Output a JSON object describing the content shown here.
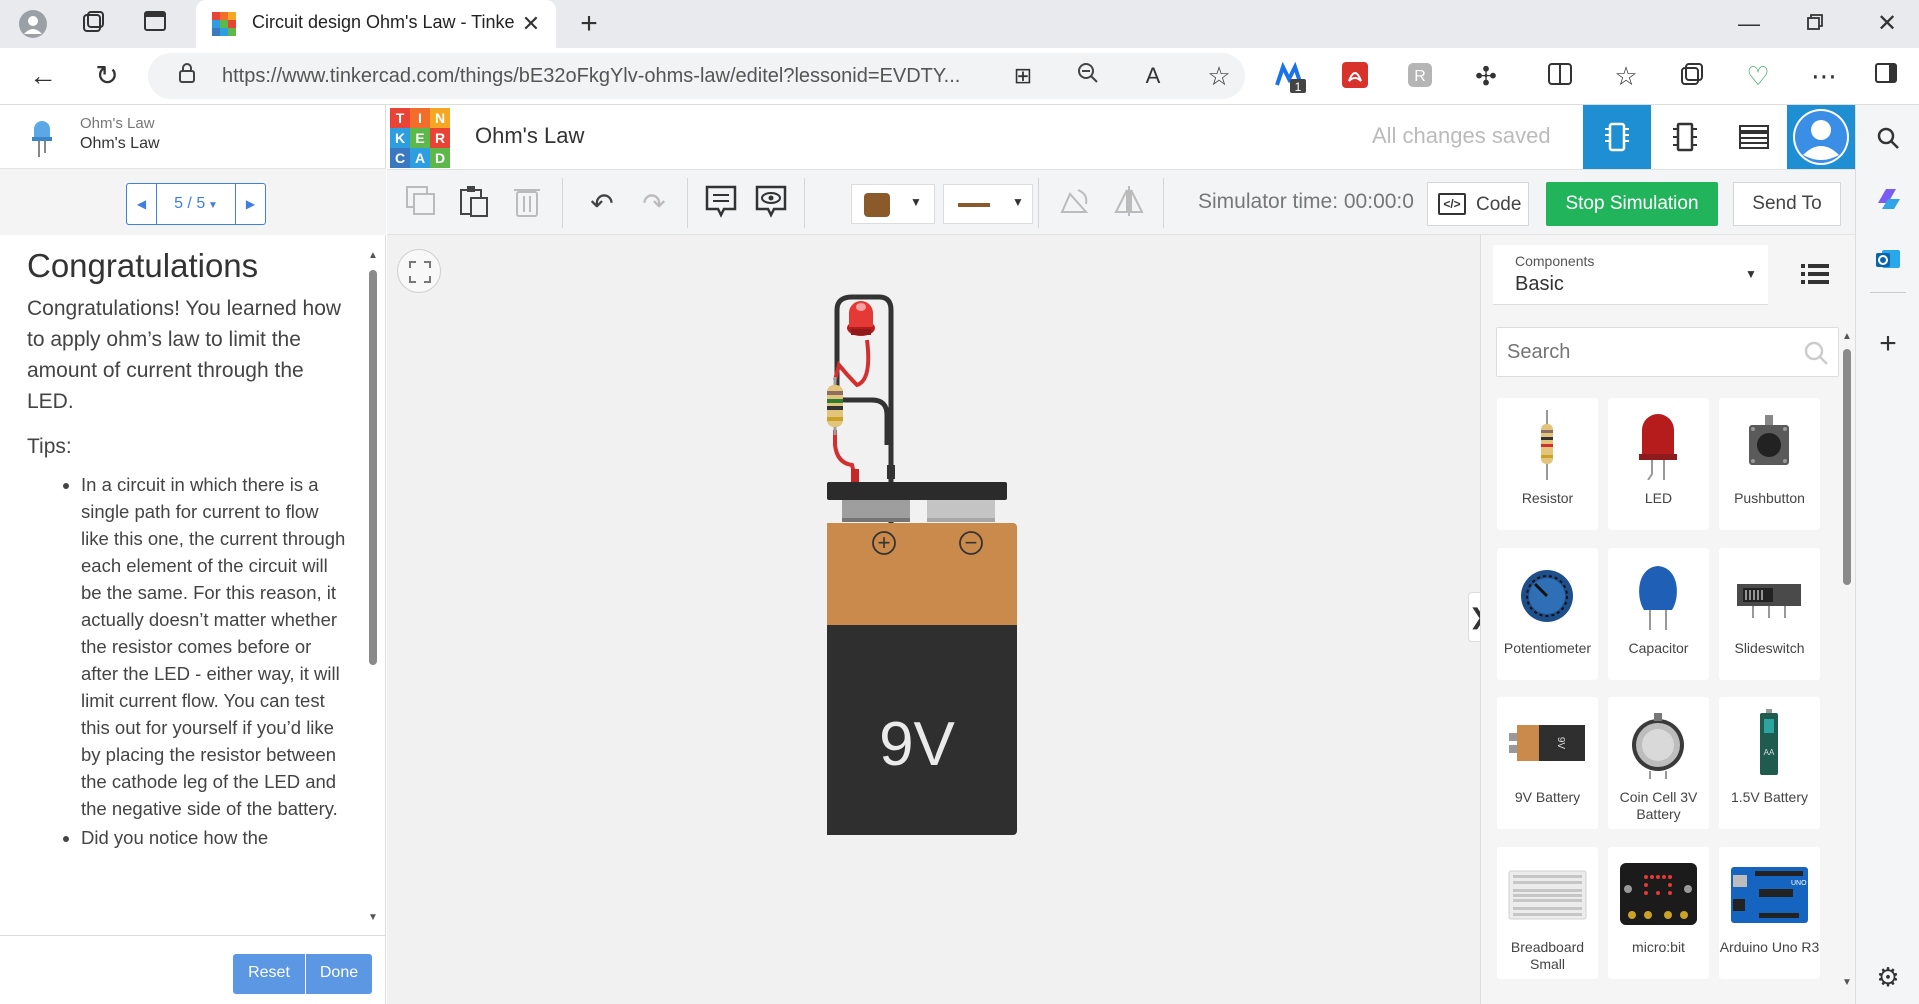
{
  "browser": {
    "tab_title": "Circuit design Ohm's Law - Tinke",
    "url": "https://www.tinkercad.com/things/bE32oFkgYlv-ohms-law/editel?lessonid=EVDTY...",
    "extension_badge": "1"
  },
  "lesson": {
    "project_name": "Ohm's Law",
    "lesson_name": "Ohm's Law",
    "pager": "5 / 5",
    "heading": "Congratulations",
    "intro": "Congratulations! You learned how to apply ohm’s law to limit the amount of current through the LED.",
    "tips_label": "Tips:",
    "tips": [
      "In a circuit in which there is a single path for current to flow like this one, the current through each element of the circuit will be the same. For this reason, it actually doesn’t matter whether the resistor comes before or after the LED - either way, it will limit current flow. You can test this out for yourself if you’d like by placing the resistor between the cathode leg of the LED and the negative side of the battery.",
      "Did you notice how the"
    ],
    "reset_label": "Reset",
    "done_label": "Done"
  },
  "header": {
    "logo_letters": [
      "T",
      "I",
      "N",
      "K",
      "E",
      "R",
      "C",
      "A",
      "D"
    ],
    "design_title": "Ohm's Law",
    "save_status": "All changes saved"
  },
  "toolbar": {
    "simulator_time": "Simulator time: 00:00:0",
    "code_label": "Code",
    "stop_label": "Stop Simulation",
    "send_label": "Send To"
  },
  "colors": {
    "accent_blue": "#1f8fd4",
    "stop_green": "#21b45b",
    "battery_orange": "#c98a4c",
    "battery_black": "#2f2f2f"
  },
  "circuit": {
    "battery_label": "9V",
    "plus_symbol": "+",
    "minus_symbol": "−"
  },
  "components": {
    "select_caption": "Components",
    "select_value": "Basic",
    "search_placeholder": "Search",
    "items": [
      {
        "label": "Resistor",
        "icon": "resistor-icon"
      },
      {
        "label": "LED",
        "icon": "led-icon"
      },
      {
        "label": "Pushbutton",
        "icon": "pushbutton-icon"
      },
      {
        "label": "Potentiometer",
        "icon": "potentiometer-icon"
      },
      {
        "label": "Capacitor",
        "icon": "capacitor-icon"
      },
      {
        "label": "Slideswitch",
        "icon": "slideswitch-icon"
      },
      {
        "label": "9V Battery",
        "icon": "battery-9v-icon"
      },
      {
        "label": "Coin Cell 3V Battery",
        "icon": "coin-cell-icon"
      },
      {
        "label": "1.5V Battery",
        "icon": "battery-aa-icon"
      },
      {
        "label": "Breadboard Small",
        "icon": "breadboard-icon"
      },
      {
        "label": "micro:bit",
        "icon": "microbit-icon"
      },
      {
        "label": "Arduino Uno R3",
        "icon": "arduino-icon"
      }
    ]
  }
}
